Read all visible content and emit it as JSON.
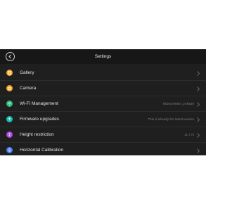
{
  "header": {
    "title": "Settings"
  },
  "colors": {
    "background": "#1f1f1f",
    "header": "#171717",
    "gallery": "#f5a623",
    "camera": "#f5a623",
    "wifi": "#2ec27e",
    "firmware": "#19bfb0",
    "height": "#b04ae6",
    "calibration": "#4a7cf5"
  },
  "settings": {
    "items": [
      {
        "label": "Gallery",
        "icon": "gallery-icon",
        "value": ""
      },
      {
        "label": "Camera",
        "icon": "camera-icon",
        "value": ""
      },
      {
        "label": "Wi-Fi Management",
        "icon": "wifi-icon",
        "value": "MiDroneMini_2A6520"
      },
      {
        "label": "Firmware upgrades",
        "icon": "firmware-icon",
        "value": "This is already the latest version"
      },
      {
        "label": "Height restriction",
        "icon": "height-icon",
        "value": "11.7 m"
      },
      {
        "label": "Horizontal Calibration",
        "icon": "calibration-icon",
        "value": ""
      }
    ]
  }
}
